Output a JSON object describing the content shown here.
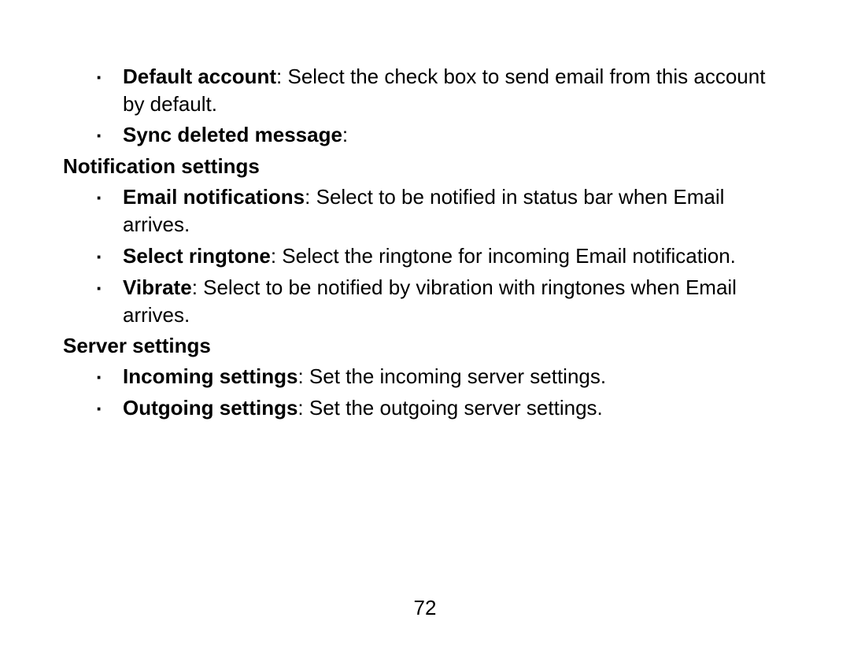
{
  "bullet_char": "·",
  "section1": {
    "items": [
      {
        "term": "Default account",
        "desc": ": Select the check box to send email from this account by default."
      },
      {
        "term": "Sync deleted message",
        "desc": ":"
      }
    ]
  },
  "heading2": "Notification settings",
  "section2": {
    "items": [
      {
        "term": "Email notifications",
        "desc": ": Select to be notified in status bar when Email arrives."
      },
      {
        "term": "Select ringtone",
        "desc": ": Select the ringtone for incoming Email notification."
      },
      {
        "term": "Vibrate",
        "desc": ": Select to be notified by vibration with ringtones when Email arrives."
      }
    ]
  },
  "heading3": "Server settings",
  "section3": {
    "items": [
      {
        "term": "Incoming settings",
        "desc": ": Set the incoming server settings."
      },
      {
        "term": "Outgoing settings",
        "desc": ": Set the outgoing server settings."
      }
    ]
  },
  "page_number": "72"
}
